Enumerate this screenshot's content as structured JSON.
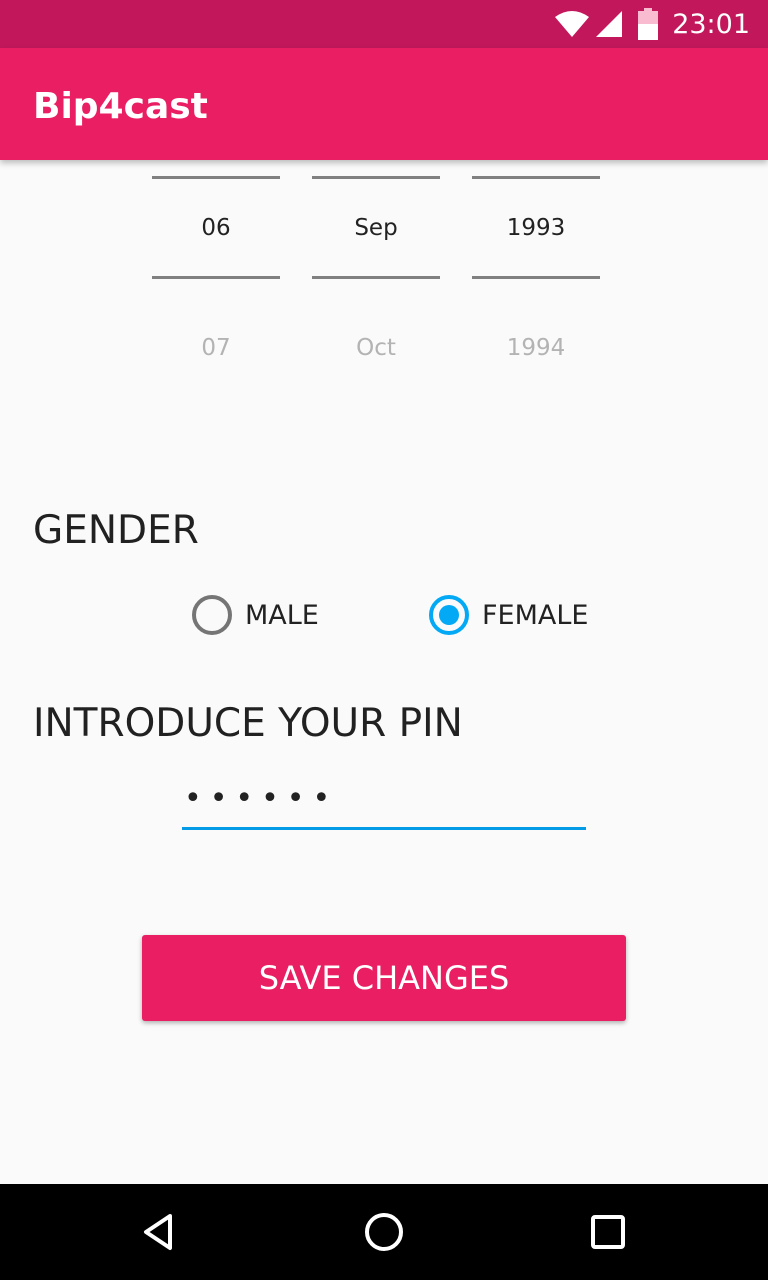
{
  "status_bar": {
    "time": "23:01"
  },
  "app_bar": {
    "title": "Bip4cast"
  },
  "date_picker": {
    "day": {
      "current": "06",
      "next": "07"
    },
    "month": {
      "current": "Sep",
      "next": "Oct"
    },
    "year": {
      "current": "1993",
      "next": "1994"
    }
  },
  "gender": {
    "title": "GENDER",
    "options": [
      {
        "label": "MALE",
        "checked": false
      },
      {
        "label": "FEMALE",
        "checked": true
      }
    ]
  },
  "pin": {
    "title": "INTRODUCE YOUR PIN",
    "value": "••••••"
  },
  "save_button": {
    "label": "SAVE CHANGES"
  },
  "colors": {
    "status_bar": "#c2185b",
    "app_bar": "#e91e63",
    "accent": "#03a9f4",
    "button": "#e91e63"
  },
  "icons": {
    "status": [
      "wifi-icon",
      "signal-icon",
      "battery-icon"
    ],
    "nav": [
      "back-icon",
      "home-icon",
      "recents-icon"
    ]
  }
}
